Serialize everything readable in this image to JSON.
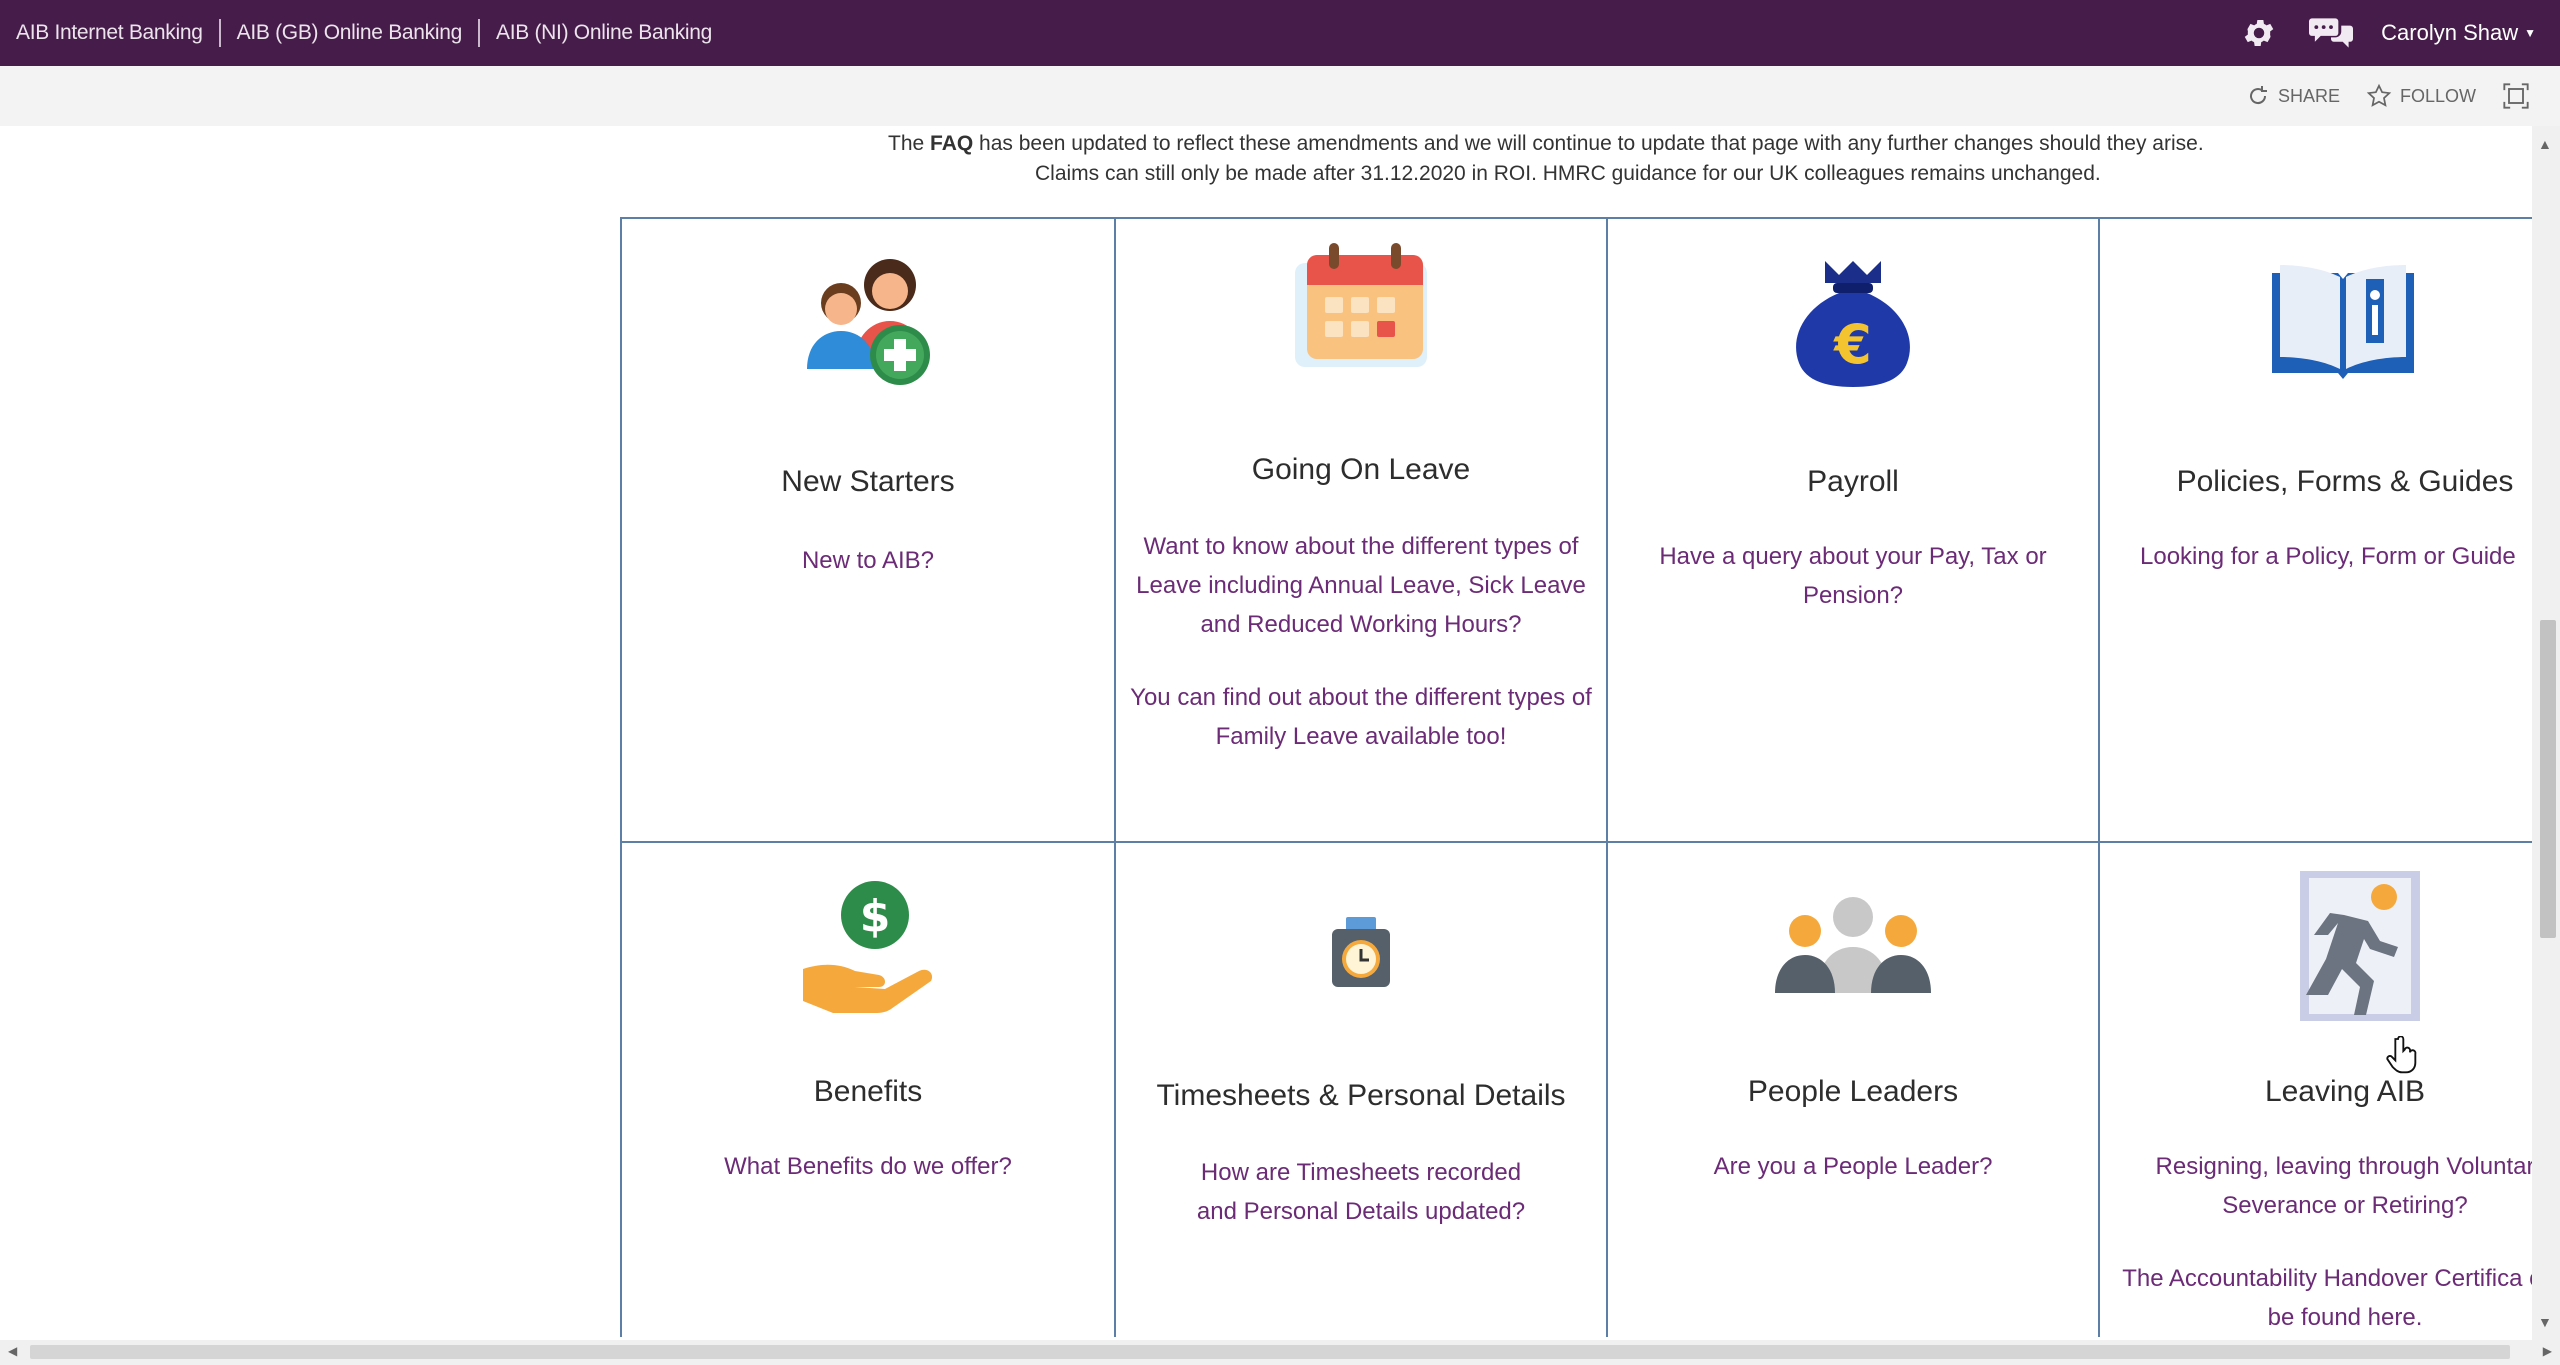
{
  "suitebar": {
    "links": [
      "AIB Internet Banking",
      "AIB (GB) Online Banking",
      "AIB (NI) Online Banking"
    ],
    "user_name": "Carolyn Shaw",
    "settings_icon": "gear-icon",
    "chat_icon": "chat-bubbles-icon",
    "background": "#461d4a"
  },
  "actionbar": {
    "share_label": "SHARE",
    "follow_label": "FOLLOW"
  },
  "notice": {
    "line1_pre": "The ",
    "line1_bold": "FAQ",
    "line1_post": " has been updated to reflect these amendments and we will continue to update that page with any further changes should they arise.",
    "line2": "Claims can still only be made after 31.12.2020 in ROI. HMRC guidance for our UK colleagues remains unchanged."
  },
  "tiles": [
    {
      "title": "New Starters",
      "icon": "new-starters-icon",
      "desc": [
        "New to AIB?"
      ]
    },
    {
      "title": "Going On Leave",
      "icon": "calendar-icon",
      "desc": [
        "Want to know about the different types of Leave including Annual Leave, Sick Leave and Reduced Working Hours?",
        "You can find out about the different types of Family Leave available too!"
      ]
    },
    {
      "title": "Payroll",
      "icon": "money-bag-icon",
      "desc": [
        "Have a query about your Pay, Tax or Pension?"
      ]
    },
    {
      "title": "Policies, Forms & Guides",
      "icon": "info-book-icon",
      "desc": [
        "Looking for a Policy, Form or Guide"
      ]
    },
    {
      "title": "Benefits",
      "icon": "dollar-hand-icon",
      "desc": [
        "What Benefits do we offer?"
      ]
    },
    {
      "title": "Timesheets & Personal Details",
      "icon": "timeclock-icon",
      "desc": [
        "How are Timesheets recorded and Personal Details updated?"
      ]
    },
    {
      "title": "People Leaders",
      "icon": "people-group-icon",
      "desc": [
        "Are you a People Leader?"
      ]
    },
    {
      "title": "Leaving AIB",
      "icon": "exit-door-icon",
      "desc": [
        "Resigning, leaving through Voluntar Severance or Retiring?",
        "The Accountability Handover Certifica can be found here."
      ]
    }
  ],
  "colors": {
    "tile_border": "#5d7fa6",
    "tile_link_text": "#6b2b76"
  }
}
